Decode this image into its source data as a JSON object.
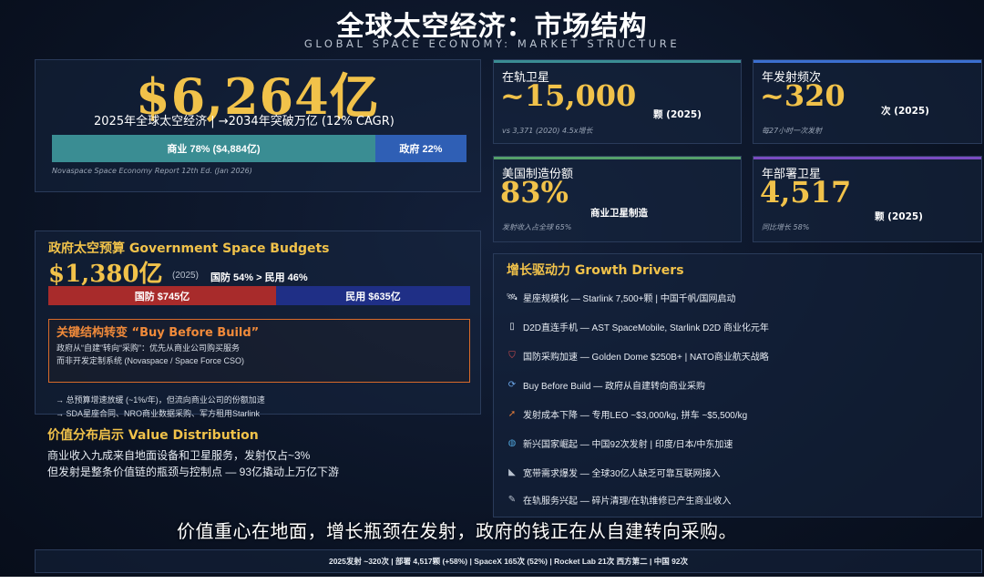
{
  "header": {
    "title": "全球太空经济：市场结构",
    "subtitle": "GLOBAL SPACE ECONOMY: MARKET STRUCTURE"
  },
  "overview": {
    "value": "$6,264亿",
    "description": "2025年全球太空经济 | →2034年突破万亿 (12% CAGR)",
    "commercial_label": "商业 78% ($4,884亿)",
    "commercial_pct": 78,
    "government_label": "政府 22%",
    "government_pct": 22,
    "source": "Novaspace Space Economy Report 12th Ed. (Jan 2026)",
    "colors": {
      "commercial": "#3a8d93",
      "government": "#2f5fb5"
    }
  },
  "stats": {
    "satellites": {
      "label": "在轨卫星",
      "value": "~15,000",
      "unit": "颗 (2025)",
      "note": "vs 3,371 (2020) 4.5x增长"
    },
    "launches": {
      "label": "年发射频次",
      "value": "~320",
      "unit": "次 (2025)",
      "note": "每27小时一次发射"
    },
    "us_manufacturing": {
      "label": "美国制造份额",
      "value": "83%",
      "unit": "商业卫星制造",
      "note": "发射收入占全球 65%"
    },
    "deployments": {
      "label": "年部署卫星",
      "value": "4,517",
      "unit": "颗 (2025)",
      "note": "同比增长 58%"
    }
  },
  "government": {
    "title": "政府太空预算 Government Space Budgets",
    "value": "$1,380亿",
    "year": "(2025)",
    "split": "国防 54% > 民用 46%",
    "defense_label": "国防 $745亿",
    "defense_pct": 54,
    "civil_label": "民用 $635亿",
    "civil_pct": 46,
    "shift": {
      "title": "关键结构转变  “Buy Before Build”",
      "line1": "政府从“自建”转向“采购”：优先从商业公司购买服务",
      "line2": "而非开发定制系统 (Novaspace / Space Force CSO)"
    },
    "bullets": [
      "→ 总预算增速放缓 (~1%/年)，但流向商业公司的份额加速",
      "→ SDA星座合同、NRO商业数据采购、军方租用Starlink"
    ]
  },
  "value_distribution": {
    "title": "价值分布启示 Value Distribution",
    "line1": "商业收入九成来自地面设备和卫星服务，发射仅占~3%",
    "line2": "但发射是整条价值链的瓶颈与控制点 — 93亿撬动上万亿下游"
  },
  "drivers": {
    "title": "增长驱动力 Growth Drivers",
    "items": [
      {
        "icon": "satellite-icon",
        "glyph": "🛰",
        "text": "星座规模化 — Starlink 7,500+颗 | 中国千帆/国网启动"
      },
      {
        "icon": "phone-icon",
        "glyph": "▯",
        "text": "D2D直连手机 — AST SpaceMobile, Starlink D2D 商业化元年"
      },
      {
        "icon": "shield-icon",
        "glyph": "⛉",
        "text": "国防采购加速 — Golden Dome $250B+ | NATO商业航天战略"
      },
      {
        "icon": "cycle-icon",
        "glyph": "⟳",
        "text": "Buy Before Build — 政府从自建转向商业采购"
      },
      {
        "icon": "rocket-icon",
        "glyph": "➚",
        "text": "发射成本下降 — 专用LEO ~$3,000/kg, 拼车 ~$5,500/kg"
      },
      {
        "icon": "globe-icon",
        "glyph": "◍",
        "text": "新兴国家崛起 — 中国92次发射 | 印度/日本/中东加速"
      },
      {
        "icon": "antenna-icon",
        "glyph": "◣",
        "text": "宽带需求爆发 — 全球30亿人缺乏可靠互联网接入"
      },
      {
        "icon": "wrench-icon",
        "glyph": "✎",
        "text": "在轨服务兴起 — 碎片清理/在轨维修已产生商业收入"
      }
    ]
  },
  "caption": "价值重心在地面，增长瓶颈在发射，政府的钱正在从自建转向采购。",
  "footer": "2025发射 ~320次  |  部署 4,517颗 (+58%)  |  SpaceX 165次 (52%)  |  Rocket Lab 21次 西方第二  |  中国 92次"
}
